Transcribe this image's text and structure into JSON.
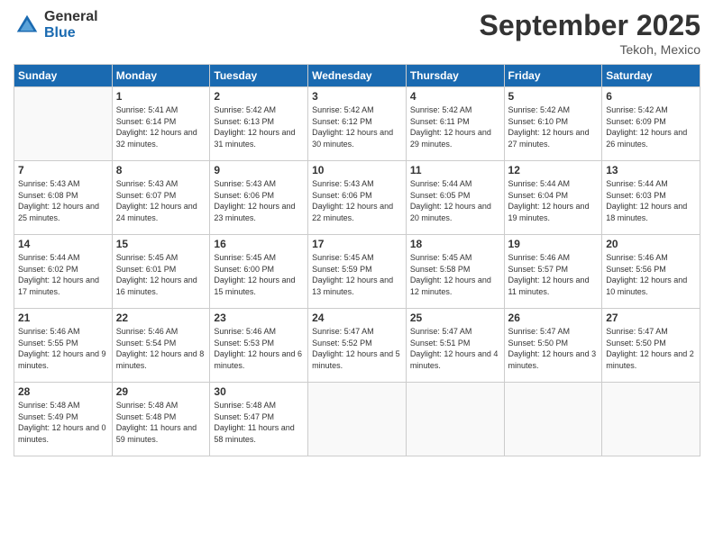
{
  "logo": {
    "general": "General",
    "blue": "Blue"
  },
  "header": {
    "month": "September 2025",
    "location": "Tekoh, Mexico"
  },
  "weekdays": [
    "Sunday",
    "Monday",
    "Tuesday",
    "Wednesday",
    "Thursday",
    "Friday",
    "Saturday"
  ],
  "days": [
    {
      "date": "",
      "info": ""
    },
    {
      "date": "1",
      "sunrise": "Sunrise: 5:41 AM",
      "sunset": "Sunset: 6:14 PM",
      "daylight": "Daylight: 12 hours and 32 minutes."
    },
    {
      "date": "2",
      "sunrise": "Sunrise: 5:42 AM",
      "sunset": "Sunset: 6:13 PM",
      "daylight": "Daylight: 12 hours and 31 minutes."
    },
    {
      "date": "3",
      "sunrise": "Sunrise: 5:42 AM",
      "sunset": "Sunset: 6:12 PM",
      "daylight": "Daylight: 12 hours and 30 minutes."
    },
    {
      "date": "4",
      "sunrise": "Sunrise: 5:42 AM",
      "sunset": "Sunset: 6:11 PM",
      "daylight": "Daylight: 12 hours and 29 minutes."
    },
    {
      "date": "5",
      "sunrise": "Sunrise: 5:42 AM",
      "sunset": "Sunset: 6:10 PM",
      "daylight": "Daylight: 12 hours and 27 minutes."
    },
    {
      "date": "6",
      "sunrise": "Sunrise: 5:42 AM",
      "sunset": "Sunset: 6:09 PM",
      "daylight": "Daylight: 12 hours and 26 minutes."
    },
    {
      "date": "7",
      "sunrise": "Sunrise: 5:43 AM",
      "sunset": "Sunset: 6:08 PM",
      "daylight": "Daylight: 12 hours and 25 minutes."
    },
    {
      "date": "8",
      "sunrise": "Sunrise: 5:43 AM",
      "sunset": "Sunset: 6:07 PM",
      "daylight": "Daylight: 12 hours and 24 minutes."
    },
    {
      "date": "9",
      "sunrise": "Sunrise: 5:43 AM",
      "sunset": "Sunset: 6:06 PM",
      "daylight": "Daylight: 12 hours and 23 minutes."
    },
    {
      "date": "10",
      "sunrise": "Sunrise: 5:43 AM",
      "sunset": "Sunset: 6:06 PM",
      "daylight": "Daylight: 12 hours and 22 minutes."
    },
    {
      "date": "11",
      "sunrise": "Sunrise: 5:44 AM",
      "sunset": "Sunset: 6:05 PM",
      "daylight": "Daylight: 12 hours and 20 minutes."
    },
    {
      "date": "12",
      "sunrise": "Sunrise: 5:44 AM",
      "sunset": "Sunset: 6:04 PM",
      "daylight": "Daylight: 12 hours and 19 minutes."
    },
    {
      "date": "13",
      "sunrise": "Sunrise: 5:44 AM",
      "sunset": "Sunset: 6:03 PM",
      "daylight": "Daylight: 12 hours and 18 minutes."
    },
    {
      "date": "14",
      "sunrise": "Sunrise: 5:44 AM",
      "sunset": "Sunset: 6:02 PM",
      "daylight": "Daylight: 12 hours and 17 minutes."
    },
    {
      "date": "15",
      "sunrise": "Sunrise: 5:45 AM",
      "sunset": "Sunset: 6:01 PM",
      "daylight": "Daylight: 12 hours and 16 minutes."
    },
    {
      "date": "16",
      "sunrise": "Sunrise: 5:45 AM",
      "sunset": "Sunset: 6:00 PM",
      "daylight": "Daylight: 12 hours and 15 minutes."
    },
    {
      "date": "17",
      "sunrise": "Sunrise: 5:45 AM",
      "sunset": "Sunset: 5:59 PM",
      "daylight": "Daylight: 12 hours and 13 minutes."
    },
    {
      "date": "18",
      "sunrise": "Sunrise: 5:45 AM",
      "sunset": "Sunset: 5:58 PM",
      "daylight": "Daylight: 12 hours and 12 minutes."
    },
    {
      "date": "19",
      "sunrise": "Sunrise: 5:46 AM",
      "sunset": "Sunset: 5:57 PM",
      "daylight": "Daylight: 12 hours and 11 minutes."
    },
    {
      "date": "20",
      "sunrise": "Sunrise: 5:46 AM",
      "sunset": "Sunset: 5:56 PM",
      "daylight": "Daylight: 12 hours and 10 minutes."
    },
    {
      "date": "21",
      "sunrise": "Sunrise: 5:46 AM",
      "sunset": "Sunset: 5:55 PM",
      "daylight": "Daylight: 12 hours and 9 minutes."
    },
    {
      "date": "22",
      "sunrise": "Sunrise: 5:46 AM",
      "sunset": "Sunset: 5:54 PM",
      "daylight": "Daylight: 12 hours and 8 minutes."
    },
    {
      "date": "23",
      "sunrise": "Sunrise: 5:46 AM",
      "sunset": "Sunset: 5:53 PM",
      "daylight": "Daylight: 12 hours and 6 minutes."
    },
    {
      "date": "24",
      "sunrise": "Sunrise: 5:47 AM",
      "sunset": "Sunset: 5:52 PM",
      "daylight": "Daylight: 12 hours and 5 minutes."
    },
    {
      "date": "25",
      "sunrise": "Sunrise: 5:47 AM",
      "sunset": "Sunset: 5:51 PM",
      "daylight": "Daylight: 12 hours and 4 minutes."
    },
    {
      "date": "26",
      "sunrise": "Sunrise: 5:47 AM",
      "sunset": "Sunset: 5:50 PM",
      "daylight": "Daylight: 12 hours and 3 minutes."
    },
    {
      "date": "27",
      "sunrise": "Sunrise: 5:47 AM",
      "sunset": "Sunset: 5:50 PM",
      "daylight": "Daylight: 12 hours and 2 minutes."
    },
    {
      "date": "28",
      "sunrise": "Sunrise: 5:48 AM",
      "sunset": "Sunset: 5:49 PM",
      "daylight": "Daylight: 12 hours and 0 minutes."
    },
    {
      "date": "29",
      "sunrise": "Sunrise: 5:48 AM",
      "sunset": "Sunset: 5:48 PM",
      "daylight": "Daylight: 11 hours and 59 minutes."
    },
    {
      "date": "30",
      "sunrise": "Sunrise: 5:48 AM",
      "sunset": "Sunset: 5:47 PM",
      "daylight": "Daylight: 11 hours and 58 minutes."
    }
  ]
}
